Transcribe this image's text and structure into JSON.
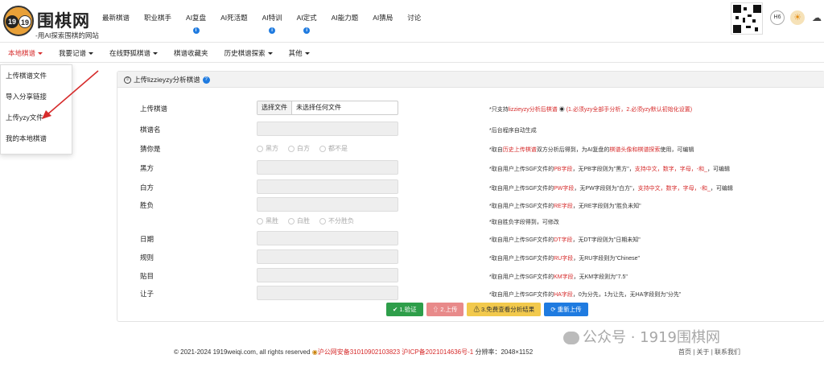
{
  "brand": {
    "badge_left": "19",
    "badge_right": "19",
    "title": "围棋网",
    "slogan": "-用AI探索围棋的网站"
  },
  "topnav": [
    {
      "label": "最新棋谱",
      "info": false
    },
    {
      "label": "职业棋手",
      "info": false
    },
    {
      "label": "AI复盘",
      "info": true
    },
    {
      "label": "AI死活题",
      "info": false
    },
    {
      "label": "AI特训",
      "info": true
    },
    {
      "label": "AI定式",
      "info": true
    },
    {
      "label": "AI能力题",
      "info": false
    },
    {
      "label": "AI猜局",
      "info": false
    },
    {
      "label": "讨论",
      "info": false
    }
  ],
  "header_right": {
    "h6_label": "H6",
    "sun_icon": "sun-icon",
    "cloud_icon": "cloud-upload-icon"
  },
  "subnav": [
    {
      "label": "本地棋谱",
      "caret": true,
      "active": true
    },
    {
      "label": "我要记谱",
      "caret": true,
      "active": false
    },
    {
      "label": "在线野狐棋谱",
      "caret": true,
      "active": false
    },
    {
      "label": "棋谱收藏夹",
      "caret": false,
      "active": false
    },
    {
      "label": "历史棋谱探索",
      "caret": true,
      "active": false
    },
    {
      "label": "其他",
      "caret": true,
      "active": false
    }
  ],
  "dropdown": [
    "上传棋谱文件",
    "导入分享链接",
    "上传yzy文件",
    "我的本地棋谱"
  ],
  "panel": {
    "title": "上传lizzieyzy分析棋谱",
    "file_button": "选择文件",
    "file_status": "未选择任何文件",
    "labels": {
      "upload": "上传棋谱",
      "name": "棋谱名",
      "guess": "猜你是",
      "black": "黑方",
      "white": "白方",
      "result": "胜负",
      "date": "日期",
      "rules": "规则",
      "komi": "贴目",
      "handicap": "让子"
    },
    "guess_options": [
      "黑方",
      "白方",
      "都不是"
    ],
    "result_options": [
      "黑胜",
      "白胜",
      "不分胜负"
    ],
    "hints": {
      "upload": {
        "a": "*只支持",
        "b": "lizzieyzy分析后棋谱",
        "c": "(1.必须yzy全部手分析，2.必须yzy默认初始化设置)"
      },
      "name": "*后台程序自动生成",
      "guess": {
        "a": "*取自",
        "b": "历史上传棋谱",
        "c": "双方分析后得到，为AI复盘的",
        "d": "棋谱头像和棋谱探索",
        "e": "使用，可编辑"
      },
      "black": {
        "a": "*取自用户上传SGF文件的",
        "b": "PB字段",
        "c": "，无PB字段则为\"黑方\"，",
        "d": "支持中文，数字，字母，-和_",
        "e": "，可编辑"
      },
      "white": {
        "a": "*取自用户上传SGF文件的",
        "b": "PW字段",
        "c": "，无PW字段则为\"白方\"，",
        "d": "支持中文，数字，字母，-和_",
        "e": "，可编辑"
      },
      "result": {
        "a": "*取自用户上传SGF文件的",
        "b": "RE字段",
        "c": "，无RE字段则为\"胜负未知\""
      },
      "result2": "*取自胜负字段得到，可修改",
      "date": {
        "a": "*取自用户上传SGF文件的",
        "b": "DT字段",
        "c": "，无DT字段则为\"日期未知\""
      },
      "rules": {
        "a": "*取自用户上传SGF文件的",
        "b": "RU字段",
        "c": "，无RU字段则为\"Chinese\""
      },
      "komi": {
        "a": "*取自用户上传SGF文件的",
        "b": "KM字段",
        "c": "，无KM字段则为\"7.5\""
      },
      "handicap": {
        "a": "*取自用户上传SGF文件的",
        "b": "HA字段",
        "c": "，0为分先，1为让先，无HA字段则为\"分先\""
      }
    },
    "buttons": [
      {
        "label": "✔ 1.验证",
        "color": "#2e9e4a"
      },
      {
        "label": "⇧ 2.上传",
        "color": "#e88a8a"
      },
      {
        "label": "⚠ 3.免费查看分析结果",
        "color": "#f2c94c"
      },
      {
        "label": "⟳ 重新上传",
        "color": "#1f7be0"
      }
    ]
  },
  "footer": {
    "copyright": "© 2021-2024 1919weiqi.com, all rights reserved",
    "police": "沪公网安备31010902103823",
    "icp": "沪ICP备2021014636号-1",
    "resolution": "分辨率：2048×1152",
    "links": "首页 | 关于 | 联系我们"
  },
  "watermark": "公众号 · 1919围棋网",
  "colors": {
    "accent_red": "#d62b2b",
    "info_blue": "#1f7be0"
  }
}
